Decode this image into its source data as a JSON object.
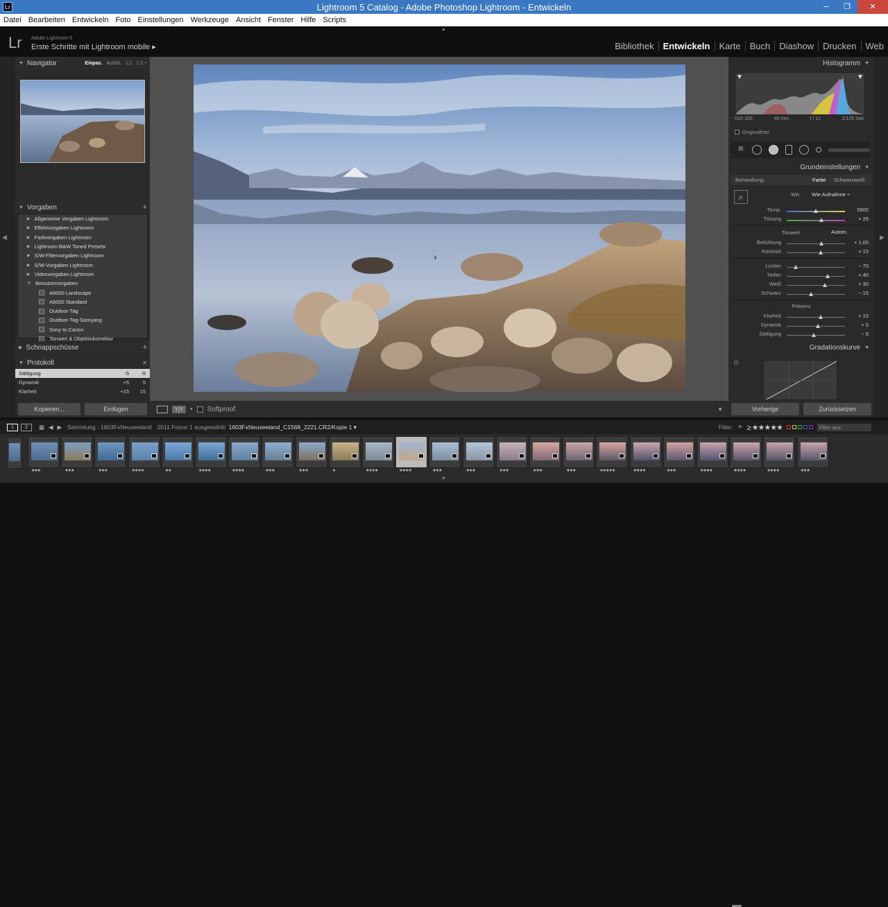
{
  "window": {
    "title": "Lightroom 5 Catalog - Adobe Photoshop Lightroom - Entwickeln",
    "minimize": "─",
    "maximize": "❐",
    "close": "✕"
  },
  "menu": [
    "Datei",
    "Bearbeiten",
    "Entwickeln",
    "Foto",
    "Einstellungen",
    "Werkzeuge",
    "Ansicht",
    "Fenster",
    "Hilfe",
    "Scripts"
  ],
  "identity": {
    "logo": "Lr",
    "product": "Adobe Lightroom 5",
    "name": "Erste Schritte mit Lightroom mobile ▸"
  },
  "modules": [
    {
      "label": "Bibliothek",
      "active": false
    },
    {
      "label": "Entwickeln",
      "active": true
    },
    {
      "label": "Karte",
      "active": false
    },
    {
      "label": "Buch",
      "active": false
    },
    {
      "label": "Diashow",
      "active": false
    },
    {
      "label": "Drucken",
      "active": false
    },
    {
      "label": "Web",
      "active": false
    }
  ],
  "navigator": {
    "title": "Navigator",
    "options": [
      "Einpas.",
      "Ausfül.",
      "1:1",
      "1:2 ÷"
    ]
  },
  "presets": {
    "title": "Vorgaben",
    "add": "+",
    "folders": [
      "Allgemeine Vorgaben Lightroom",
      "Effektvorgaben Lightroom",
      "Farbvorgaben Lightroom",
      "Lightroom B&W Toned Presets",
      "S/W-Filtervorgaben Lightroom",
      "S/W-Vorgaben Lightroom",
      "Videovorgaben Lightroom",
      "Benutzervorgaben"
    ],
    "user_items": [
      "A6000 Landscape",
      "A6000 Standard",
      "Outdoor-Tag",
      "Outdoor-Tag-Samyang",
      "Sony to Canon",
      "Tonwert & Objektivkorrektur"
    ]
  },
  "snapshots": {
    "title": "Schnappschüsse",
    "add": "+"
  },
  "history": {
    "title": "Protokoll",
    "close": "✕",
    "rows": [
      {
        "label": "Sättigung",
        "v1": "-5",
        "v2": "-5"
      },
      {
        "label": "Dynamik",
        "v1": "+5",
        "v2": "5"
      },
      {
        "label": "Klarheit",
        "v1": "+15",
        "v2": "15"
      }
    ]
  },
  "left_buttons": {
    "copy": "Kopieren...",
    "paste": "Einfügen"
  },
  "toolbar": {
    "softproof": "Softproof"
  },
  "histogram": {
    "title": "Histogramm",
    "iso": "ISO 100",
    "focal": "45 mm",
    "aperture": "f / 11",
    "shutter": "1/125 Sek.",
    "original": "Originalfoto"
  },
  "basic": {
    "title": "Grundeinstellungen",
    "treatment_label": "Behandlung:",
    "treatment_color": "Farbe",
    "treatment_bw": "Schwarzweiß",
    "wb_label": "WA:",
    "wb_value": "Wie Aufnahme ÷",
    "tone_label": "Tonwert",
    "tone_auto": "Autom.",
    "presence_label": "Präsenz",
    "sliders": [
      {
        "key": "temp",
        "label": "Temp.",
        "value": "5900",
        "pos": 0.5
      },
      {
        "key": "tint",
        "label": "Tönung",
        "value": "+ 26",
        "pos": 0.6
      },
      {
        "key": "exposure",
        "label": "Belichtung",
        "value": "+ 1,00",
        "pos": 0.6
      },
      {
        "key": "contrast",
        "label": "Kontrast",
        "value": "+ 15",
        "pos": 0.58
      },
      {
        "key": "highlights",
        "label": "Lichter",
        "value": "− 70",
        "pos": 0.15
      },
      {
        "key": "shadows",
        "label": "Tiefen",
        "value": "+ 40",
        "pos": 0.7
      },
      {
        "key": "whites",
        "label": "Weiß",
        "value": "+ 30",
        "pos": 0.65
      },
      {
        "key": "blacks",
        "label": "Schwarz",
        "value": "− 15",
        "pos": 0.42
      },
      {
        "key": "clarity",
        "label": "Klarheit",
        "value": "+ 15",
        "pos": 0.58
      },
      {
        "key": "vibrance",
        "label": "Dynamik",
        "value": "+ 5",
        "pos": 0.54
      },
      {
        "key": "saturation",
        "label": "Sättigung",
        "value": "− 5",
        "pos": 0.46
      }
    ]
  },
  "tonecurve": {
    "title": "Gradationskurve"
  },
  "right_buttons": {
    "previous": "Vorherige",
    "reset": "Zurücksetzen"
  },
  "filmbar": {
    "screen1": "1",
    "screen2": "2",
    "path": "Sammlung : 1603FxNeuseeland",
    "count": "2011 Fotos/ 1 ausgewählt/",
    "filename": "1603FxNeuseeland_C1568_2221.CR2/Kopie 1 ▾",
    "filter_label": "Filter:",
    "filter_stars": "≥ ★★★★★",
    "filter_off": "Filter aus"
  },
  "thumbnails": [
    {
      "stars": "★★★",
      "colors": [
        "#6e8fb8",
        "#4d6b8c"
      ],
      "selected": false
    },
    {
      "stars": "★★★",
      "colors": [
        "#7e9fc2",
        "#8c7a5c"
      ],
      "selected": false
    },
    {
      "stars": "★★★",
      "colors": [
        "#6f96c0",
        "#3e6b93"
      ],
      "selected": false
    },
    {
      "stars": "★★★★",
      "colors": [
        "#7aa0cc",
        "#5a82a8"
      ],
      "selected": false
    },
    {
      "stars": "★★",
      "colors": [
        "#7da6d6",
        "#4b78a6"
      ],
      "selected": false
    },
    {
      "stars": "★★★★",
      "colors": [
        "#7ea6d0",
        "#3f6f9c"
      ],
      "selected": false
    },
    {
      "stars": "★★★★",
      "colors": [
        "#8aa8c8",
        "#5e7f9e"
      ],
      "selected": false
    },
    {
      "stars": "★★★",
      "colors": [
        "#91aed0",
        "#667f95"
      ],
      "selected": false
    },
    {
      "stars": "★★★",
      "colors": [
        "#8ba9cc",
        "#7c6f5e"
      ],
      "selected": false
    },
    {
      "stars": "★",
      "colors": [
        "#c9b38a",
        "#8a7a55"
      ],
      "selected": false
    },
    {
      "stars": "★★★★",
      "colors": [
        "#a9b8c6",
        "#7d8a97"
      ],
      "selected": false
    },
    {
      "stars": "★★★★",
      "colors": [
        "#9fb6d0",
        "#c2a68a"
      ],
      "selected": true
    },
    {
      "stars": "★★★",
      "colors": [
        "#a9bfd6",
        "#7b8ea0"
      ],
      "selected": false
    },
    {
      "stars": "★★★",
      "colors": [
        "#b3c6d8",
        "#8797a6"
      ],
      "selected": false
    },
    {
      "stars": "★★★",
      "colors": [
        "#c4b3b8",
        "#8a7b88"
      ],
      "selected": false
    },
    {
      "stars": "★★★",
      "colors": [
        "#d6a8a0",
        "#806878"
      ],
      "selected": false
    },
    {
      "stars": "★★★",
      "colors": [
        "#c9a8a8",
        "#6e6472"
      ],
      "selected": false
    },
    {
      "stars": "★★★★★",
      "colors": [
        "#d8a7a0",
        "#5e5666"
      ],
      "selected": false
    },
    {
      "stars": "★★★★",
      "colors": [
        "#cda6ae",
        "#54506a"
      ],
      "selected": false
    },
    {
      "stars": "★★★",
      "colors": [
        "#d0a2a2",
        "#5f596e"
      ],
      "selected": false
    },
    {
      "stars": "★★★★",
      "colors": [
        "#c8a3ad",
        "#55526b"
      ],
      "selected": false
    },
    {
      "stars": "★★★★",
      "colors": [
        "#caa6ab",
        "#5a566c"
      ],
      "selected": false
    },
    {
      "stars": "★★★★",
      "colors": [
        "#c7a4aa",
        "#58546a"
      ],
      "selected": false
    },
    {
      "stars": "★★★",
      "colors": [
        "#c6a3a9",
        "#5a566a"
      ],
      "selected": false
    }
  ]
}
